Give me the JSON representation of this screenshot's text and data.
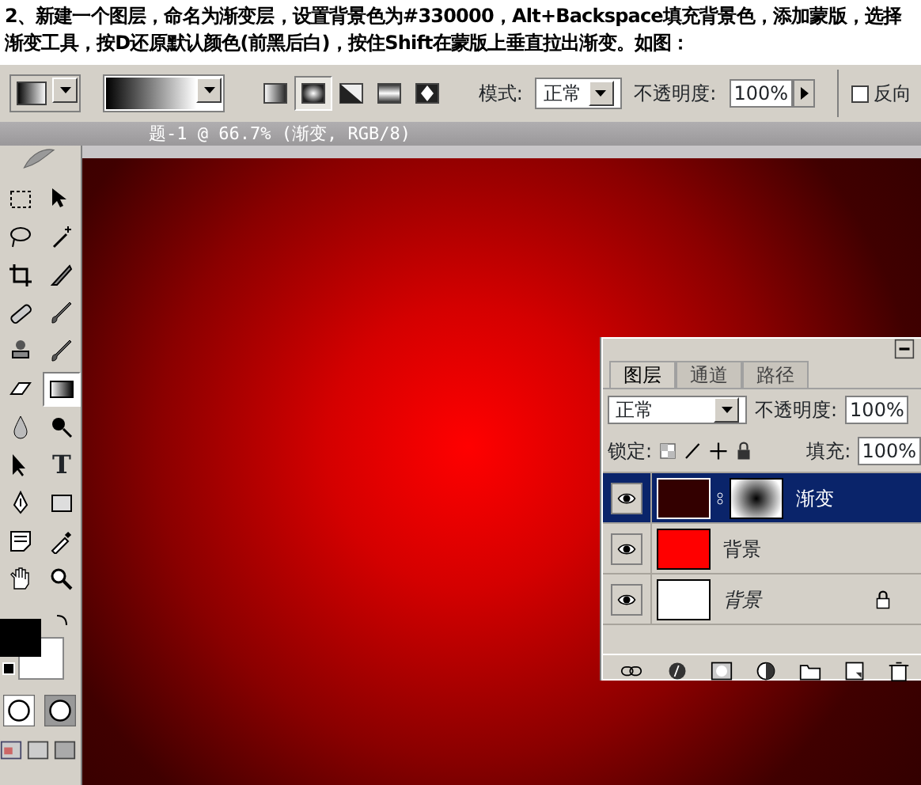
{
  "caption": "2、新建一个图层，命名为渐变层，设置背景色为#330000，Alt+Backspace填充背景色，添加蒙版，选择渐变工具，按D还原默认颜色(前黑后白)，按住Shift在蒙版上垂直拉出渐变。如图：",
  "options_bar": {
    "gradient_types": [
      {
        "kind": "linear",
        "selected": false
      },
      {
        "kind": "radial",
        "selected": true
      },
      {
        "kind": "angle",
        "selected": false
      },
      {
        "kind": "reflected",
        "selected": false
      },
      {
        "kind": "diamond",
        "selected": false
      }
    ],
    "mode_label": "模式:",
    "mode_value": "正常",
    "opacity_label": "不透明度:",
    "opacity_value": "100%",
    "reverse": {
      "label": "反向",
      "checked": false
    }
  },
  "document": {
    "title": "题-1 @ 66.7% (渐变, RGB/8)"
  },
  "toolbox": {
    "tools": [
      {
        "kind": "marquee",
        "selected": false
      },
      {
        "kind": "move",
        "selected": false
      },
      {
        "kind": "lasso",
        "selected": false
      },
      {
        "kind": "wand",
        "selected": false
      },
      {
        "kind": "crop",
        "selected": false
      },
      {
        "kind": "knife",
        "selected": false
      },
      {
        "kind": "bandage",
        "selected": false
      },
      {
        "kind": "brush",
        "selected": false
      },
      {
        "kind": "stamp",
        "selected": false
      },
      {
        "kind": "brush",
        "selected": false
      },
      {
        "kind": "eraser",
        "selected": false
      },
      {
        "kind": "gradient",
        "selected": true
      },
      {
        "kind": "drop",
        "selected": false
      },
      {
        "kind": "burn",
        "selected": false
      },
      {
        "kind": "pointer",
        "selected": false
      },
      {
        "kind": "text",
        "label": "T",
        "selected": false
      },
      {
        "kind": "pen",
        "selected": false
      },
      {
        "kind": "shape",
        "selected": false
      },
      {
        "kind": "note",
        "selected": false
      },
      {
        "kind": "eyedropper",
        "selected": false
      },
      {
        "kind": "hand",
        "selected": false
      },
      {
        "kind": "zoom",
        "selected": false
      }
    ]
  },
  "layers_panel": {
    "tabs": [
      {
        "label": "图层",
        "selected": true
      },
      {
        "label": "通道",
        "selected": false
      },
      {
        "label": "路径",
        "selected": false
      }
    ],
    "blend_mode": "正常",
    "opacity_label": "不透明度:",
    "opacity_value": "100%",
    "lock_label": "锁定:",
    "fill_label": "填充:",
    "fill_value": "100%",
    "layers": [
      {
        "name": "渐变",
        "kind": "layer",
        "selected": true,
        "color": "#330000",
        "has_mask": true,
        "locked": false
      },
      {
        "name": "背景",
        "kind": "layer",
        "selected": false,
        "color": "#ff0000",
        "has_mask": false,
        "locked": false
      },
      {
        "name": "背景",
        "kind": "background",
        "selected": false,
        "color": "#ffffff",
        "has_mask": false,
        "locked": true
      }
    ]
  }
}
